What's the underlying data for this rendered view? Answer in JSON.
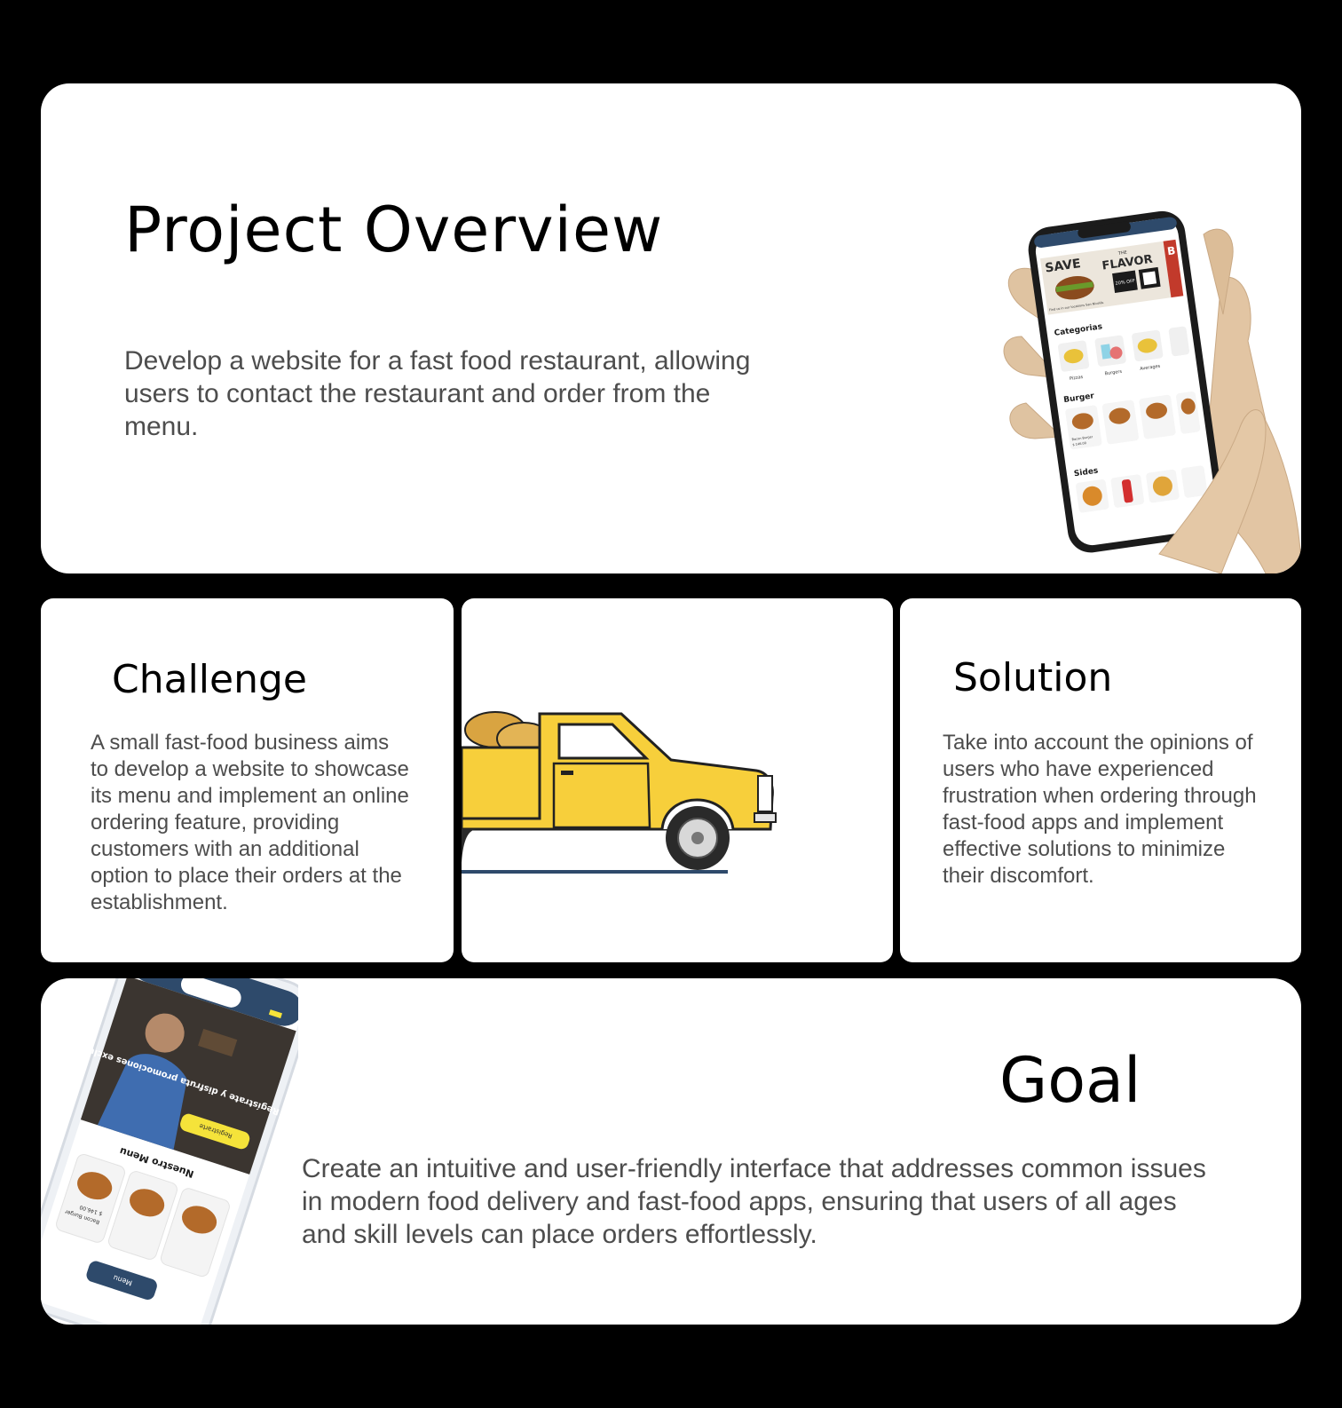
{
  "overview": {
    "title": "Project Overview",
    "text": "Develop a website for a fast food restaurant, allowing users to contact the restaurant and order from the menu.",
    "phone": {
      "banner_left": "SAVE",
      "banner_the": "THE",
      "banner_right": "FLAVOR",
      "banner_discount": "20% OFF",
      "banner_tail": "B",
      "banner_caption": "Find us in our locations San Nicolás",
      "section_categories": "Categorias",
      "categories": [
        "Pizzas",
        "Burgers",
        "Averages"
      ],
      "section_burger": "Burger",
      "burger_item_name": "Bacon Burger",
      "burger_item_price": "$ 146.00",
      "section_sides": "Sides"
    }
  },
  "challenge": {
    "title": "Challenge",
    "text": "A small fast-food business aims to develop a website to showcase its menu and implement an online ordering feature, providing customers with an additional option to place their orders at the establishment."
  },
  "solution": {
    "title": "Solution",
    "text": "Take into account the opinions of users who have experienced frustration when ordering through fast-food apps and implement effective solutions to minimize their discomfort."
  },
  "goal": {
    "title": "Goal",
    "text": "Create an intuitive and user-friendly interface that addresses common issues in modern food delivery and fast-food apps, ensuring that users of all ages and skill levels can place orders effortlessly.",
    "phone": {
      "hero_text": "Regístrate y disfruta promociones exclusivas",
      "hero_button": "Registrarte",
      "section_title": "Nuestro Menu",
      "item_name": "Bacon Burger",
      "item_price": "$ 146.00",
      "menu_button": "Menu"
    }
  },
  "colors": {
    "background": "#000000",
    "card": "#ffffff",
    "heading": "#000000",
    "body_text": "#4d4d4d",
    "phone_navy": "#2e4a6b",
    "truck_yellow": "#f7cf3b",
    "accent_yellow": "#f5e33a",
    "hand_wood": "#e2c5a3"
  }
}
